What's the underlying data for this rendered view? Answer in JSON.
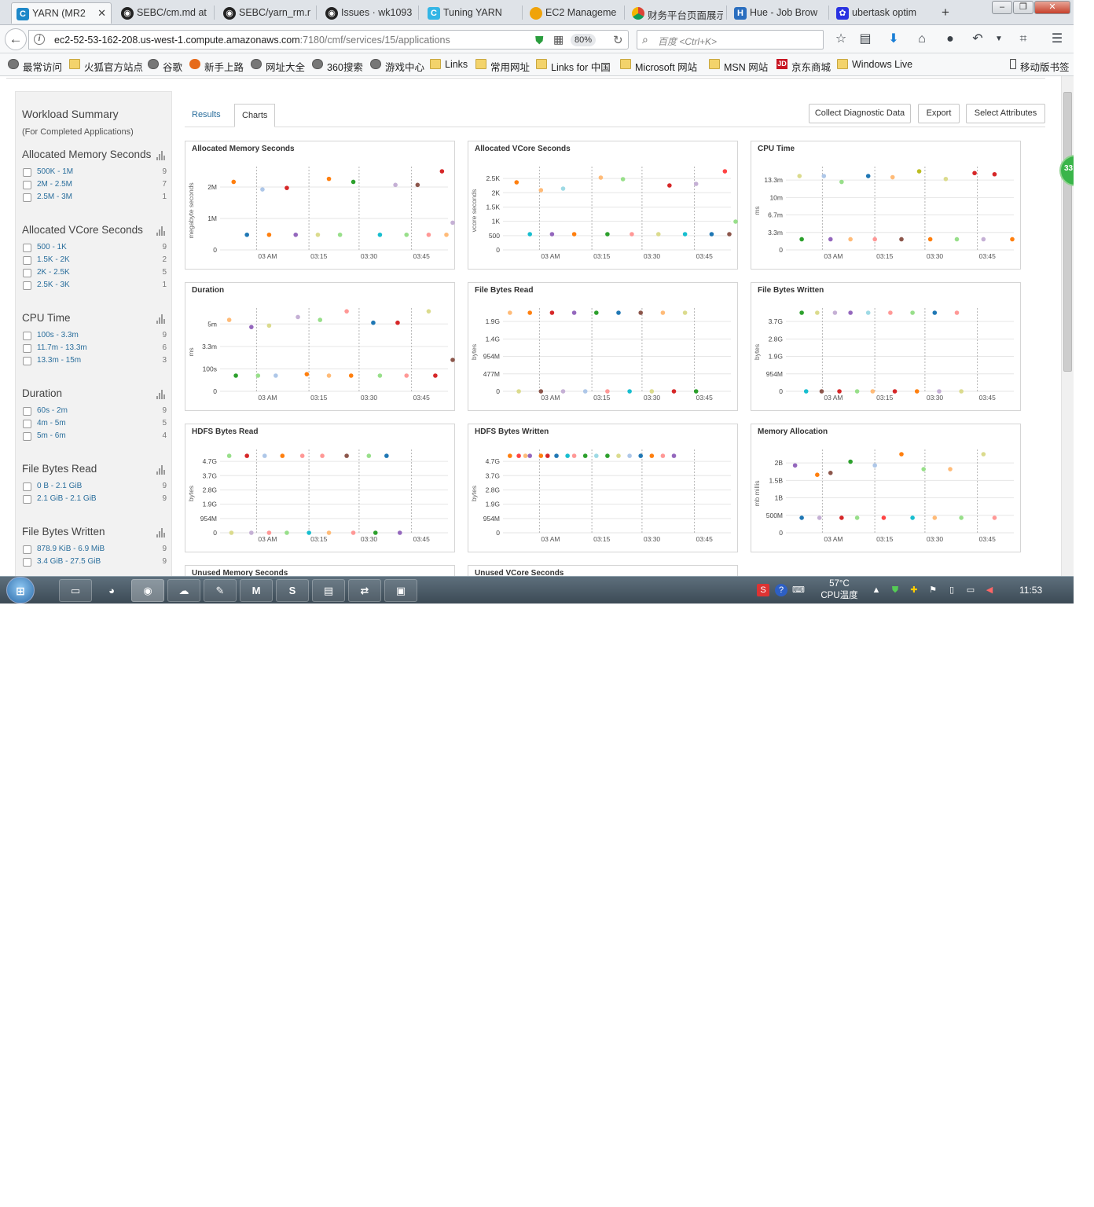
{
  "browser": {
    "tabs": [
      {
        "title": "YARN (MR2",
        "icon": "cloudera-icon",
        "active": true
      },
      {
        "title": "SEBC/cm.md at",
        "icon": "github-icon"
      },
      {
        "title": "SEBC/yarn_rm.r",
        "icon": "github-icon"
      },
      {
        "title": "Issues · wk1093",
        "icon": "github-icon"
      },
      {
        "title": "Tuning YARN",
        "icon": "cloudera-icon"
      },
      {
        "title": "EC2 Manageme",
        "icon": "aws-icon"
      },
      {
        "title": "财务平台页面展示",
        "icon": "chrome-icon"
      },
      {
        "title": "Hue - Job Brow",
        "icon": "hue-icon"
      },
      {
        "title": "ubertask optim",
        "icon": "baidu-icon"
      }
    ],
    "url_host": "ec2-52-53-162-208.us-west-1.compute.amazonaws.com",
    "url_path": ":7180/cmf/services/15/applications",
    "zoom": "80%",
    "search_placeholder": "百度 <Ctrl+K>",
    "bookmarks": [
      {
        "label": "最常访问",
        "icon": "globe"
      },
      {
        "label": "火狐官方站点",
        "icon": "folder"
      },
      {
        "label": "谷歌",
        "icon": "globe"
      },
      {
        "label": "新手上路",
        "icon": "ff"
      },
      {
        "label": "网址大全",
        "icon": "globe"
      },
      {
        "label": "360搜索",
        "icon": "globe"
      },
      {
        "label": "游戏中心",
        "icon": "globe"
      },
      {
        "label": "Links",
        "icon": "folder"
      },
      {
        "label": "常用网址",
        "icon": "folder"
      },
      {
        "label": "Links for 中国",
        "icon": "folder"
      },
      {
        "label": "Microsoft 网站",
        "icon": "folder"
      },
      {
        "label": "MSN 网站",
        "icon": "folder"
      },
      {
        "label": "京东商城",
        "icon": "jd"
      },
      {
        "label": "Windows Live",
        "icon": "folder"
      }
    ],
    "mobile_bookmarks": "移动版书签"
  },
  "sidebar": {
    "title": "Workload Summary",
    "subtitle": "(For Completed Applications)",
    "sections": [
      {
        "title": "Allocated Memory Seconds",
        "items": [
          {
            "label": "500K - 1M",
            "count": "9"
          },
          {
            "label": "2M - 2.5M",
            "count": "7"
          },
          {
            "label": "2.5M - 3M",
            "count": "1"
          }
        ]
      },
      {
        "title": "Allocated VCore Seconds",
        "items": [
          {
            "label": "500 - 1K",
            "count": "9"
          },
          {
            "label": "1.5K - 2K",
            "count": "2"
          },
          {
            "label": "2K - 2.5K",
            "count": "5"
          },
          {
            "label": "2.5K - 3K",
            "count": "1"
          }
        ]
      },
      {
        "title": "CPU Time",
        "items": [
          {
            "label": "100s - 3.3m",
            "count": "9"
          },
          {
            "label": "11.7m - 13.3m",
            "count": "6"
          },
          {
            "label": "13.3m - 15m",
            "count": "3"
          }
        ]
      },
      {
        "title": "Duration",
        "items": [
          {
            "label": "60s - 2m",
            "count": "9"
          },
          {
            "label": "4m - 5m",
            "count": "5"
          },
          {
            "label": "5m - 6m",
            "count": "4"
          }
        ]
      },
      {
        "title": "File Bytes Read",
        "items": [
          {
            "label": "0 B - 2.1 GiB",
            "count": "9"
          },
          {
            "label": "2.1 GiB - 2.1 GiB",
            "count": "9"
          }
        ]
      },
      {
        "title": "File Bytes Written",
        "items": [
          {
            "label": "878.9 KiB - 6.9 MiB",
            "count": "9"
          },
          {
            "label": "3.4 GiB - 27.5 GiB",
            "count": "9"
          }
        ]
      }
    ]
  },
  "main": {
    "tab_results": "Results",
    "tab_charts": "Charts",
    "btn_diag": "Collect Diagnostic Data",
    "btn_export": "Export",
    "btn_select": "Select Attributes",
    "notification_count": "33"
  },
  "colors": [
    "#1f77b4",
    "#ff7f0e",
    "#2ca02c",
    "#d62728",
    "#9467bd",
    "#8c564b",
    "#e377c2",
    "#7f7f7f",
    "#bcbd22",
    "#17becf",
    "#aec7e8",
    "#ffbb78",
    "#98df8a",
    "#ff9896",
    "#c5b0d5",
    "#c49c94",
    "#f7b6d2",
    "#dbdb8d",
    "#9edae5",
    "#ff4444"
  ],
  "chart_data": [
    {
      "type": "scatter",
      "title": "Allocated Memory Seconds",
      "ylabel": "megabyte seconds",
      "xticks": [
        "03 AM",
        "03:15",
        "03:30",
        "03:45"
      ],
      "yticks": [
        "0",
        "1M",
        "2M"
      ],
      "ylim": [
        0,
        2600000
      ],
      "points": [
        [
          0.04,
          2250000,
          1
        ],
        [
          0.1,
          500000,
          0
        ],
        [
          0.17,
          2000000,
          10
        ],
        [
          0.2,
          500000,
          1
        ],
        [
          0.28,
          2050000,
          3
        ],
        [
          0.32,
          500000,
          4
        ],
        [
          0.42,
          500000,
          17
        ],
        [
          0.47,
          2350000,
          1
        ],
        [
          0.52,
          500000,
          12
        ],
        [
          0.58,
          2250000,
          2
        ],
        [
          0.7,
          500000,
          9
        ],
        [
          0.77,
          2150000,
          14
        ],
        [
          0.82,
          500000,
          12
        ],
        [
          0.87,
          2150000,
          5
        ],
        [
          0.92,
          500000,
          13
        ],
        [
          0.98,
          2600000,
          3
        ],
        [
          1.0,
          500000,
          11
        ],
        [
          1.05,
          900000,
          14
        ]
      ]
    },
    {
      "type": "scatter",
      "title": "Allocated VCore Seconds",
      "ylabel": "vcore seconds",
      "xticks": [
        "03 AM",
        "03:15",
        "03:30",
        "03:45"
      ],
      "yticks": [
        "0",
        "500",
        "1K",
        "1.5K",
        "2K",
        "2.5K"
      ],
      "ylim": [
        0,
        2500
      ],
      "points": [
        [
          0.04,
          2150,
          1
        ],
        [
          0.1,
          500,
          9
        ],
        [
          0.15,
          1900,
          11
        ],
        [
          0.2,
          500,
          4
        ],
        [
          0.25,
          1950,
          18
        ],
        [
          0.3,
          500,
          1
        ],
        [
          0.42,
          2300,
          11
        ],
        [
          0.45,
          500,
          2
        ],
        [
          0.52,
          2250,
          12
        ],
        [
          0.56,
          500,
          13
        ],
        [
          0.68,
          500,
          17
        ],
        [
          0.73,
          2050,
          3
        ],
        [
          0.8,
          500,
          9
        ],
        [
          0.85,
          2100,
          14
        ],
        [
          0.92,
          500,
          0
        ],
        [
          0.98,
          2500,
          19
        ],
        [
          1.0,
          500,
          5
        ],
        [
          1.04,
          900,
          12
        ]
      ]
    },
    {
      "type": "scatter",
      "title": "CPU Time",
      "ylabel": "ms",
      "xticks": [
        "03 AM",
        "03:15",
        "03:30",
        "03:45"
      ],
      "yticks": [
        "0",
        "3.3m",
        "6.7m",
        "10m",
        "13.3m"
      ],
      "ylim": [
        0,
        13.3
      ],
      "points": [
        [
          0.04,
          12.5,
          17
        ],
        [
          0.05,
          1.8,
          2
        ],
        [
          0.15,
          12.5,
          10
        ],
        [
          0.18,
          1.8,
          4
        ],
        [
          0.23,
          11.5,
          12
        ],
        [
          0.27,
          1.8,
          11
        ],
        [
          0.35,
          12.5,
          0
        ],
        [
          0.38,
          1.8,
          13
        ],
        [
          0.46,
          12.3,
          11
        ],
        [
          0.5,
          1.8,
          5
        ],
        [
          0.58,
          13.3,
          8
        ],
        [
          0.63,
          1.8,
          1
        ],
        [
          0.7,
          12,
          17
        ],
        [
          0.75,
          1.8,
          12
        ],
        [
          0.83,
          13,
          3
        ],
        [
          0.87,
          1.8,
          14
        ],
        [
          0.92,
          12.8,
          3
        ],
        [
          1.0,
          1.8,
          1
        ]
      ]
    },
    {
      "type": "scatter",
      "title": "Duration",
      "ylabel": "ms",
      "xticks": [
        "03 AM",
        "03:15",
        "03:30",
        "03:45"
      ],
      "yticks": [
        "0",
        "100s",
        "3.3m",
        "5m"
      ],
      "ylim": [
        0,
        5.5
      ],
      "points": [
        [
          0.02,
          5,
          11
        ],
        [
          0.05,
          1.1,
          2
        ],
        [
          0.12,
          4.5,
          4
        ],
        [
          0.15,
          1.1,
          12
        ],
        [
          0.2,
          4.6,
          17
        ],
        [
          0.23,
          1.1,
          10
        ],
        [
          0.33,
          5.2,
          14
        ],
        [
          0.37,
          1.2,
          1
        ],
        [
          0.43,
          5,
          12
        ],
        [
          0.47,
          1.1,
          11
        ],
        [
          0.55,
          5.6,
          13
        ],
        [
          0.57,
          1.1,
          1
        ],
        [
          0.67,
          4.8,
          0
        ],
        [
          0.7,
          1.1,
          12
        ],
        [
          0.78,
          4.8,
          3
        ],
        [
          0.82,
          1.1,
          13
        ],
        [
          0.92,
          5.6,
          17
        ],
        [
          0.95,
          1.1,
          3
        ],
        [
          1.03,
          2.2,
          5
        ]
      ]
    },
    {
      "type": "scatter",
      "title": "File Bytes Read",
      "ylabel": "bytes",
      "xticks": [
        "03 AM",
        "03:15",
        "03:30",
        "03:45"
      ],
      "yticks": [
        "0",
        "477M",
        "954M",
        "1.4G",
        "1.9G"
      ],
      "ylim": [
        0,
        2.1
      ],
      "points": [
        [
          0.01,
          2.1,
          11
        ],
        [
          0.05,
          0,
          17
        ],
        [
          0.1,
          2.1,
          1
        ],
        [
          0.15,
          0,
          5
        ],
        [
          0.2,
          2.1,
          3
        ],
        [
          0.25,
          0,
          14
        ],
        [
          0.3,
          2.1,
          4
        ],
        [
          0.35,
          0,
          10
        ],
        [
          0.4,
          2.1,
          2
        ],
        [
          0.45,
          0,
          13
        ],
        [
          0.5,
          2.1,
          0
        ],
        [
          0.55,
          0,
          9
        ],
        [
          0.6,
          2.1,
          5
        ],
        [
          0.65,
          0,
          17
        ],
        [
          0.7,
          2.1,
          11
        ],
        [
          0.75,
          0,
          3
        ],
        [
          0.8,
          2.1,
          17
        ],
        [
          0.85,
          0,
          2
        ]
      ]
    },
    {
      "type": "scatter",
      "title": "File Bytes Written",
      "ylabel": "bytes",
      "xticks": [
        "03 AM",
        "03:15",
        "03:30",
        "03:45"
      ],
      "yticks": [
        "0",
        "954M",
        "1.9G",
        "2.8G",
        "3.7G"
      ],
      "ylim": [
        0,
        4.3
      ],
      "points": [
        [
          0.05,
          4.3,
          2
        ],
        [
          0.07,
          0,
          9
        ],
        [
          0.12,
          4.3,
          17
        ],
        [
          0.14,
          0,
          5
        ],
        [
          0.2,
          4.3,
          14
        ],
        [
          0.22,
          0,
          3
        ],
        [
          0.27,
          4.3,
          4
        ],
        [
          0.3,
          0,
          12
        ],
        [
          0.35,
          4.3,
          18
        ],
        [
          0.37,
          0,
          11
        ],
        [
          0.45,
          4.3,
          13
        ],
        [
          0.47,
          0,
          3
        ],
        [
          0.55,
          4.3,
          12
        ],
        [
          0.57,
          0,
          1
        ],
        [
          0.65,
          4.3,
          0
        ],
        [
          0.67,
          0,
          14
        ],
        [
          0.75,
          4.3,
          13
        ],
        [
          0.77,
          0,
          17
        ]
      ]
    },
    {
      "type": "scatter",
      "title": "HDFS Bytes Read",
      "ylabel": "bytes",
      "xticks": [
        "03 AM",
        "03:15",
        "03:30",
        "03:45"
      ],
      "yticks": [
        "0",
        "954M",
        "1.9G",
        "2.8G",
        "3.7G",
        "4.7G"
      ],
      "ylim": [
        0,
        4.8
      ],
      "points": [
        [
          0.02,
          4.7,
          12
        ],
        [
          0.03,
          0,
          17
        ],
        [
          0.1,
          4.7,
          3
        ],
        [
          0.12,
          0,
          14
        ],
        [
          0.18,
          4.7,
          10
        ],
        [
          0.2,
          0,
          13
        ],
        [
          0.26,
          4.7,
          1
        ],
        [
          0.28,
          0,
          12
        ],
        [
          0.35,
          4.7,
          13
        ],
        [
          0.38,
          0,
          9
        ],
        [
          0.44,
          4.7,
          13
        ],
        [
          0.47,
          0,
          11
        ],
        [
          0.55,
          4.7,
          5
        ],
        [
          0.58,
          0,
          13
        ],
        [
          0.65,
          4.7,
          12
        ],
        [
          0.68,
          0,
          2
        ],
        [
          0.73,
          4.7,
          0
        ],
        [
          0.79,
          0,
          4
        ]
      ]
    },
    {
      "type": "scatter",
      "title": "HDFS Bytes Written",
      "ylabel": "bytes",
      "xticks": [
        "03 AM",
        "03:15",
        "03:30",
        "03:45"
      ],
      "yticks": [
        "0",
        "954M",
        "1.9G",
        "2.8G",
        "3.7G",
        "4.7G"
      ],
      "ylim": [
        0,
        4.8
      ],
      "points": [
        [
          0.01,
          4.7,
          1
        ],
        [
          0.05,
          4.7,
          19
        ],
        [
          0.08,
          4.7,
          11
        ],
        [
          0.1,
          4.7,
          4
        ],
        [
          0.15,
          4.7,
          1
        ],
        [
          0.18,
          4.7,
          3
        ],
        [
          0.22,
          4.7,
          0
        ],
        [
          0.27,
          4.7,
          9
        ],
        [
          0.3,
          4.7,
          13
        ],
        [
          0.35,
          4.7,
          2
        ],
        [
          0.4,
          4.7,
          18
        ],
        [
          0.45,
          4.7,
          2
        ],
        [
          0.5,
          4.7,
          17
        ],
        [
          0.55,
          4.7,
          10
        ],
        [
          0.6,
          4.7,
          0
        ],
        [
          0.65,
          4.7,
          1
        ],
        [
          0.7,
          4.7,
          13
        ],
        [
          0.75,
          4.7,
          4
        ]
      ]
    },
    {
      "type": "scatter",
      "title": "Memory Allocation",
      "ylabel": "mb millis",
      "xticks": [
        "03 AM",
        "03:15",
        "03:30",
        "03:45"
      ],
      "yticks": [
        "0",
        "500M",
        "1B",
        "1.5B",
        "2B"
      ],
      "ylim": [
        0,
        2100
      ],
      "points": [
        [
          0.02,
          1800,
          4
        ],
        [
          0.05,
          400,
          0
        ],
        [
          0.12,
          1550,
          1
        ],
        [
          0.13,
          400,
          14
        ],
        [
          0.18,
          1600,
          5
        ],
        [
          0.23,
          400,
          3
        ],
        [
          0.27,
          1900,
          2
        ],
        [
          0.3,
          400,
          12
        ],
        [
          0.38,
          1800,
          10
        ],
        [
          0.42,
          400,
          19
        ],
        [
          0.5,
          2100,
          1
        ],
        [
          0.55,
          400,
          9
        ],
        [
          0.6,
          1700,
          12
        ],
        [
          0.65,
          400,
          11
        ],
        [
          0.72,
          1700,
          11
        ],
        [
          0.77,
          400,
          12
        ],
        [
          0.87,
          2100,
          17
        ],
        [
          0.92,
          400,
          13
        ]
      ]
    }
  ],
  "bottom_panels": [
    "Unused Memory Seconds",
    "Unused VCore Seconds"
  ],
  "taskbar": {
    "temp": "57°C",
    "temp_label": "CPU温度",
    "time": "11:53"
  }
}
